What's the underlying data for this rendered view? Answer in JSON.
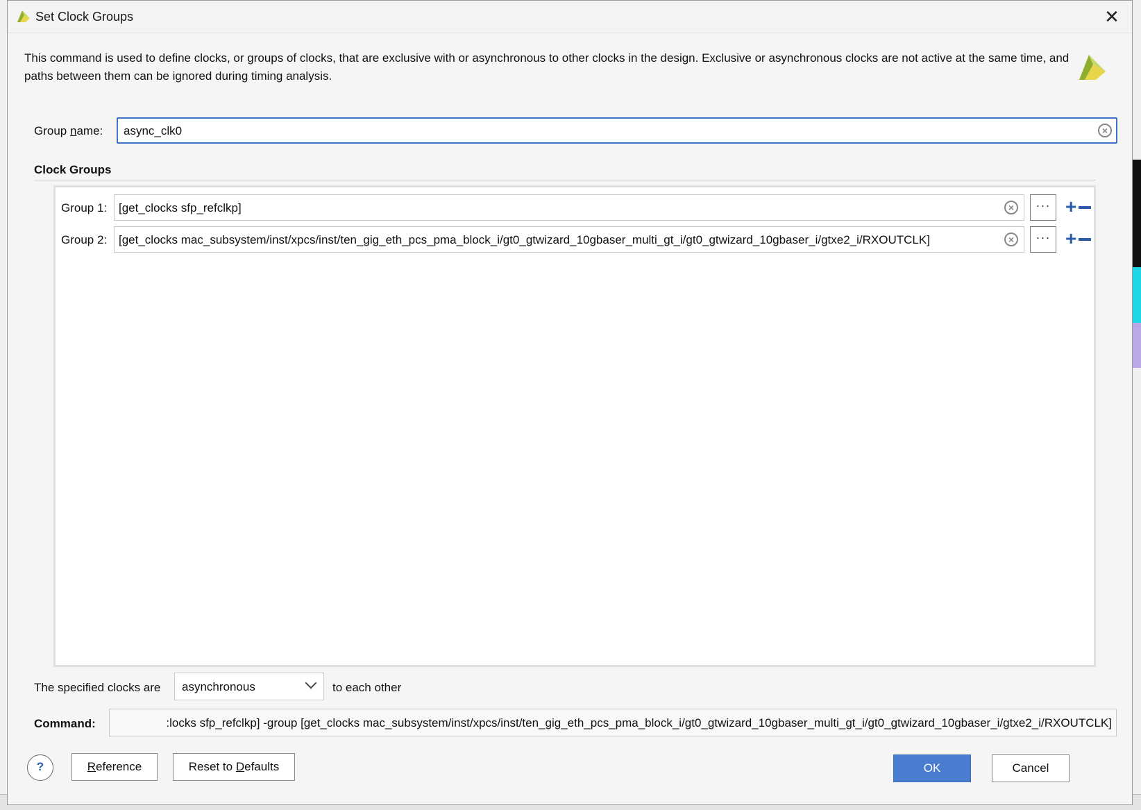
{
  "dialog": {
    "title": "Set Clock Groups",
    "description": "This command is used to define clocks, or groups of clocks, that are exclusive with or asynchronous to other clocks in the design. Exclusive or asynchronous clocks are not active at the same time, and paths between them can be ignored during timing analysis."
  },
  "group_name": {
    "label_pre": "Group ",
    "label_mnemonic": "n",
    "label_post": "ame:",
    "value": "async_clk0"
  },
  "clock_groups": {
    "title": "Clock Groups",
    "groups": [
      {
        "label": "Group 1:",
        "value": "[get_clocks sfp_refclkp]"
      },
      {
        "label": "Group 2:",
        "value": "[get_clocks mac_subsystem/inst/xpcs/inst/ten_gig_eth_pcs_pma_block_i/gt0_gtwizard_10gbaser_multi_gt_i/gt0_gtwizard_10gbaser_i/gtxe2_i/RXOUTCLK]"
      }
    ],
    "browse_label": "···",
    "add_label": "+"
  },
  "relation": {
    "prefix": "The specified clocks are",
    "selected": "asynchronous",
    "suffix": "to each other"
  },
  "command": {
    "label": "Command:",
    "value": ":locks sfp_refclkp] -group [get_clocks mac_subsystem/inst/xpcs/inst/ten_gig_eth_pcs_pma_block_i/gt0_gtwizard_10gbaser_multi_gt_i/gt0_gtwizard_10gbaser_i/gtxe2_i/RXOUTCLK]"
  },
  "buttons": {
    "help": "?",
    "reference_mnemonic": "R",
    "reference_rest": "eference",
    "reset_pre": "Reset to ",
    "reset_mnemonic": "D",
    "reset_rest": "efaults",
    "ok": "OK",
    "cancel": "Cancel"
  },
  "icons": {
    "close": "close-icon",
    "clear": "clear-circle-x-icon",
    "dropdown": "chevron-down-icon",
    "logo": "vivado-logo-icon"
  }
}
